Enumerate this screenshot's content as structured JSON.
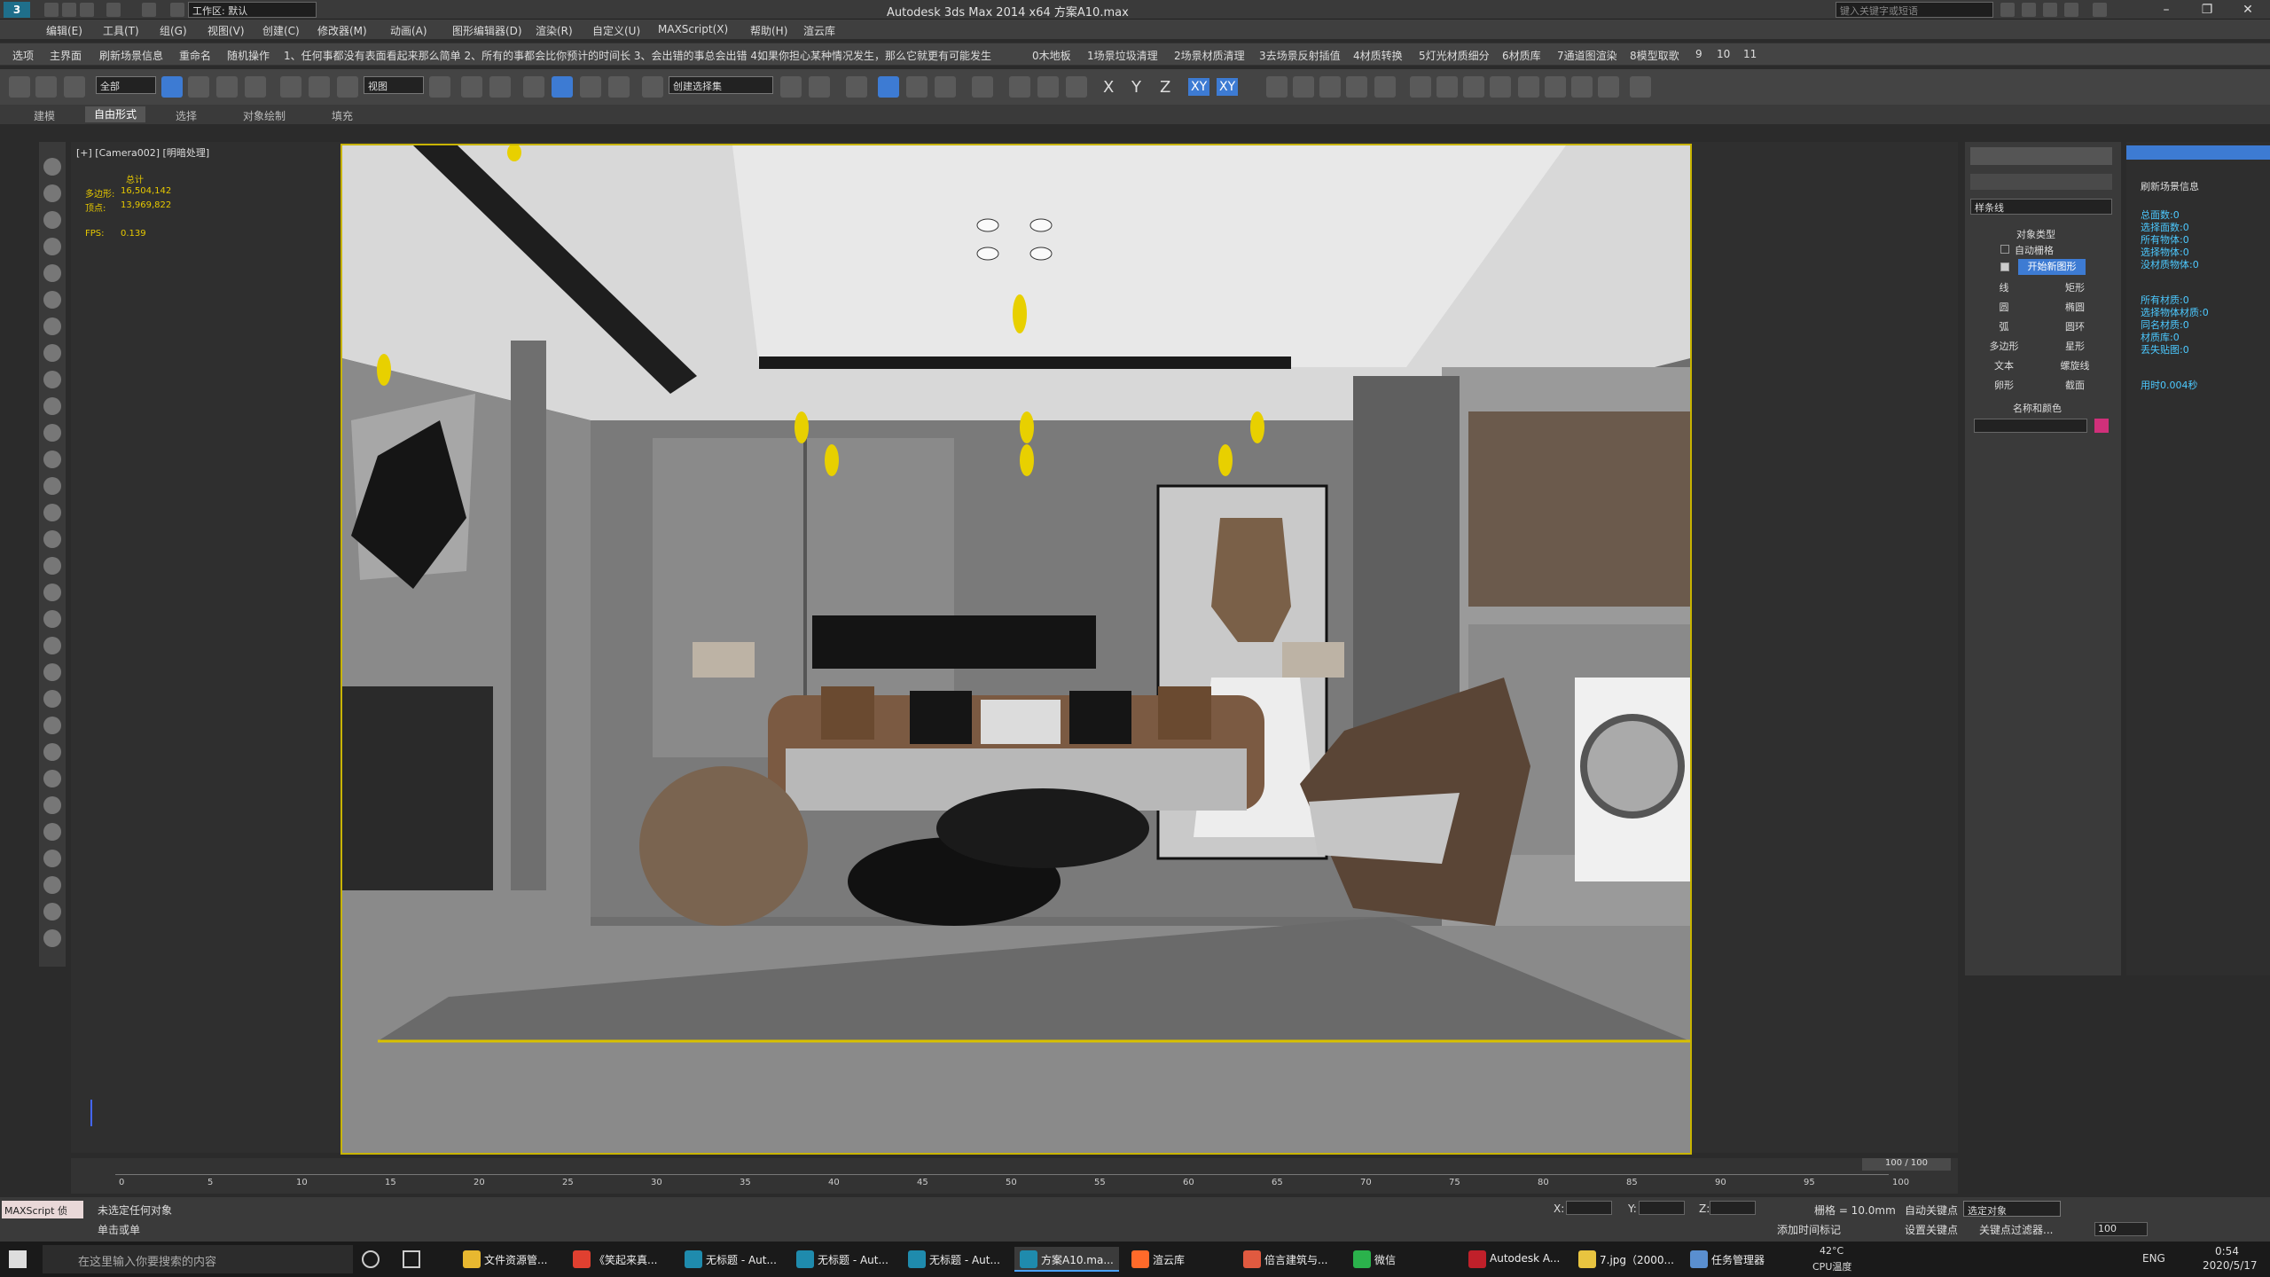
{
  "titlebar": {
    "logo": "3",
    "title": "Autodesk 3ds Max  2014 x64     方案A10.max",
    "workspace": "工作区: 默认",
    "search_placeholder": "键入关键字或短语"
  },
  "menu": [
    "编辑(E)",
    "工具(T)",
    "组(G)",
    "视图(V)",
    "创建(C)",
    "修改器(M)",
    "动画(A)",
    "图形编辑器(D)",
    "渲染(R)",
    "自定义(U)",
    "MAXScript(X)",
    "帮助(H)",
    "渲云库"
  ],
  "scriptbar": [
    "选项",
    "主界面",
    "刷新场景信息",
    "重命名",
    "随机操作",
    "1、任何事都没有表面看起来那么简单 2、所有的事都会比你预计的时间长 3、会出错的事总会出错 4如果你担心某种情况发生，那么它就更有可能发生",
    "0木地板",
    "1场景垃圾清理",
    "2场景材质清理",
    "3去场景反射插值",
    "4材质转换",
    "5灯光材质细分",
    "6材质库",
    "7通道图渲染",
    "8模型取歌",
    "9",
    "10",
    "11"
  ],
  "toolbar": {
    "filter": "全部",
    "view": "视图",
    "selection_set": "创建选择集",
    "axes": [
      "X",
      "Y",
      "Z",
      "XY",
      "XY"
    ]
  },
  "ribbon_tabs": [
    "建模",
    "自由形式",
    "选择",
    "对象绘制",
    "填充"
  ],
  "viewport": {
    "label": "[+] [Camera002] [明暗处理]",
    "stats_title": "总计",
    "polys_label": "多边形:",
    "polys": "16,504,142",
    "verts_label": "顶点:",
    "verts": "13,969,822",
    "fps_label": "FPS:",
    "fps": "0.139"
  },
  "cmdpanel": {
    "dropdown": "样条线",
    "object_type_title": "对象类型",
    "auto_grid": "自动栅格",
    "start_new_shape": "开始新图形",
    "buttons": [
      "线",
      "矩形",
      "圆",
      "椭圆",
      "弧",
      "圆环",
      "多边形",
      "星形",
      "文本",
      "螺旋线",
      "卵形",
      "截面"
    ],
    "name_color_title": "名称和颜色"
  },
  "info": {
    "title": "刷新场景信息",
    "lines": [
      "总面数:0",
      "选择面数:0",
      "所有物体:0",
      "选择物体:0",
      "没材质物体:0",
      "所有材质:0",
      "选择物体材质:0",
      "同名材质:0",
      "材质库:0",
      "丢失贴图:0",
      "用时0.004秒"
    ]
  },
  "timeline": {
    "frame": "100 / 100",
    "ticks": [
      "0",
      "5",
      "10",
      "15",
      "20",
      "25",
      "30",
      "35",
      "40",
      "45",
      "50",
      "55",
      "60",
      "65",
      "70",
      "75",
      "80",
      "85",
      "90",
      "95",
      "100"
    ]
  },
  "status": {
    "maxscript": "MAXScript 侦",
    "msg1": "未选定任何对象",
    "msg2": "单击或单",
    "x_label": "X:",
    "y_label": "Y:",
    "z_label": "Z:",
    "grid": "栅格 = 10.0mm",
    "add_time_tag": "添加时间标记",
    "auto_key": "自动关键点",
    "set_key": "设置关键点",
    "selected": "选定对象",
    "key_filter": "关键点过滤器...",
    "frame_field": "100"
  },
  "taskbar": {
    "search": "在这里输入你要搜索的内容",
    "items": [
      {
        "label": "文件资源管...",
        "color": "#e8b830"
      },
      {
        "label": "《笑起来真...",
        "color": "#e04030"
      },
      {
        "label": "无标题 - Aut...",
        "color": "#1f8bad"
      },
      {
        "label": "无标题 - Aut...",
        "color": "#1f8bad"
      },
      {
        "label": "无标题 - Aut...",
        "color": "#1f8bad"
      },
      {
        "label": "方案A10.ma...",
        "color": "#1f8bad"
      },
      {
        "label": "渲云库",
        "color": "#ff6a2a"
      },
      {
        "label": "倍言建筑与...",
        "color": "#e05a40"
      },
      {
        "label": "微信",
        "color": "#2bb24c"
      },
      {
        "label": "Autodesk A...",
        "color": "#c0202a"
      },
      {
        "label": "7.jpg（2000...",
        "color": "#e8c440"
      },
      {
        "label": "任务管理器",
        "color": "#5a8fd0"
      }
    ],
    "temp": "42°C",
    "cpu": "CPU温度",
    "lang": "ENG",
    "time": "0:54",
    "date": "2020/5/17"
  }
}
